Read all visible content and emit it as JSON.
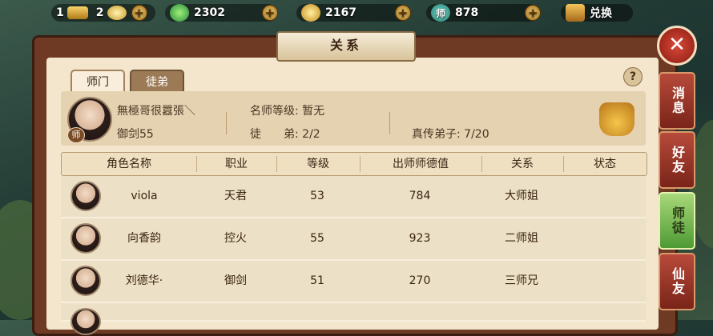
{
  "resources": {
    "item1": {
      "value": "1",
      "icon": "gold-ingot-icon"
    },
    "item2": {
      "value": "2",
      "icon": "silver-ingot-icon"
    },
    "jade": {
      "value": "2302",
      "icon": "jade-coin-icon"
    },
    "gold": {
      "value": "2167",
      "icon": "gold-coin-icon"
    },
    "master": {
      "value": "878",
      "icon": "master-token-icon",
      "glyph": "师"
    },
    "exchange": {
      "label": "兑换",
      "icon": "shop-icon"
    }
  },
  "title": "关系",
  "tabs": [
    {
      "label": "师门",
      "active": true
    },
    {
      "label": "徒弟",
      "active": false
    }
  ],
  "help_label": "?",
  "master_info": {
    "name": "無極哥很囂張＼",
    "sect": "御剑55",
    "badge": "师",
    "rank_label": "名师等级: 暂无",
    "disciple_label": "徒　　弟: 2/2",
    "true_disciple_label": "真传弟子: 7/20"
  },
  "table": {
    "headers": [
      "角色名称",
      "职业",
      "等级",
      "出师师德值",
      "关系",
      "状态"
    ],
    "rows": [
      {
        "name": "viola",
        "job": "天君",
        "level": "53",
        "virtue": "784",
        "relation": "大师姐",
        "status": ""
      },
      {
        "name": "向香韵",
        "job": "控火",
        "level": "55",
        "virtue": "923",
        "relation": "二师姐",
        "status": ""
      },
      {
        "name": "刘德华·",
        "job": "御剑",
        "level": "51",
        "virtue": "270",
        "relation": "三师兄",
        "status": ""
      }
    ]
  },
  "side_tabs": [
    {
      "label": "消息",
      "active": false
    },
    {
      "label": "好友",
      "active": false
    },
    {
      "label": "师徒",
      "active": true
    },
    {
      "label": "仙友",
      "active": false
    }
  ],
  "colors": {
    "panel": "#f3e6cd",
    "frame": "#6e3a24",
    "active_tab": "#4e9a34",
    "inactive_tab": "#7a241a"
  }
}
